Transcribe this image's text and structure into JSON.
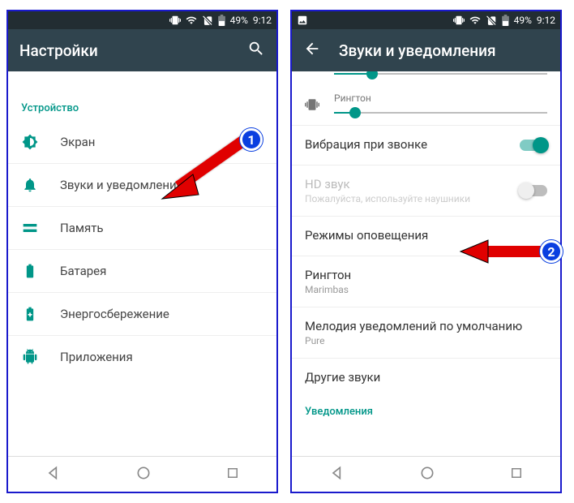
{
  "status": {
    "battery": "49%",
    "time": "9:12"
  },
  "left": {
    "title": "Настройки",
    "section": "Устройство",
    "items": [
      {
        "label": "Экран"
      },
      {
        "label": "Звуки и уведомления"
      },
      {
        "label": "Память"
      },
      {
        "label": "Батарея"
      },
      {
        "label": "Энергосбережение"
      },
      {
        "label": "Приложения"
      }
    ]
  },
  "right": {
    "title": "Звуки и уведомления",
    "ringtone_label": "Рингтон",
    "vibrate": {
      "label": "Вибрация при звонке"
    },
    "hd": {
      "label": "HD звук",
      "sub": "Пожалуйста, используйте наушники"
    },
    "modes": {
      "label": "Режимы оповещения"
    },
    "ringtone": {
      "label": "Рингтон",
      "value": "Marimbas"
    },
    "default_notif": {
      "label": "Мелодия уведомлений по умолчанию",
      "value": "Pure"
    },
    "other": {
      "label": "Другие звуки"
    },
    "notif_section": "Уведомления"
  },
  "badges": {
    "one": "1",
    "two": "2"
  }
}
